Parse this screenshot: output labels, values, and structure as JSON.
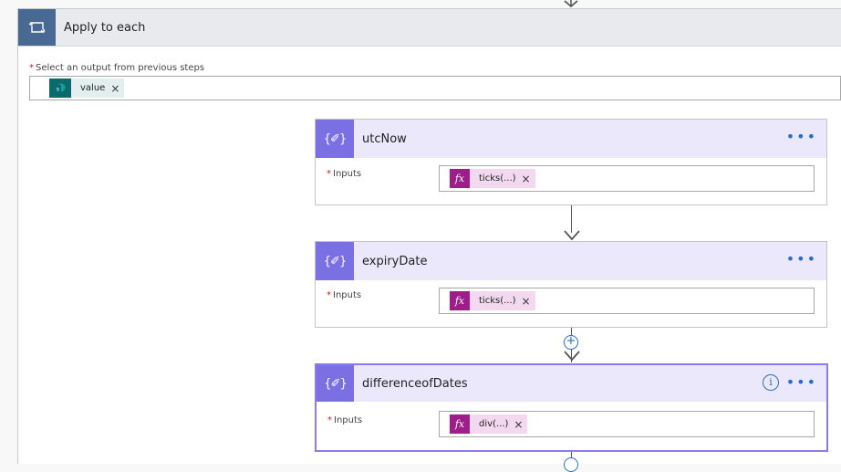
{
  "loop": {
    "title": "Apply to each",
    "select_label": "Select an output from previous steps",
    "select_token": "value"
  },
  "cards": [
    {
      "title": "utcNow",
      "inputs_label": "Inputs",
      "token": "ticks(...)"
    },
    {
      "title": "expiryDate",
      "inputs_label": "Inputs",
      "token": "ticks(...)"
    },
    {
      "title": "differenceofDates",
      "inputs_label": "Inputs",
      "token": "div(...)"
    }
  ],
  "icons": {
    "loop": "loop-icon",
    "sharepoint": "sharepoint-icon",
    "expression": "fx-icon",
    "compose": "compose-icon",
    "more": "more-options-icon",
    "info": "info-icon",
    "add": "plus-icon",
    "remove": "close-icon"
  },
  "colors": {
    "loop_tile": "#486991",
    "compose_tile": "#7b6fe4",
    "compose_header": "#ece8fc",
    "fx_tile": "#9f1c8b",
    "fx_token": "#f2d9ef",
    "sharepoint_tile": "#0b6a6c",
    "selected_border": "#8a7cf0",
    "link": "#2b6cc4"
  },
  "text": {
    "inputs_marker": "*",
    "more": "•••",
    "info": "i",
    "plus": "+",
    "x": "×",
    "fx": "fx",
    "sp": "s"
  }
}
